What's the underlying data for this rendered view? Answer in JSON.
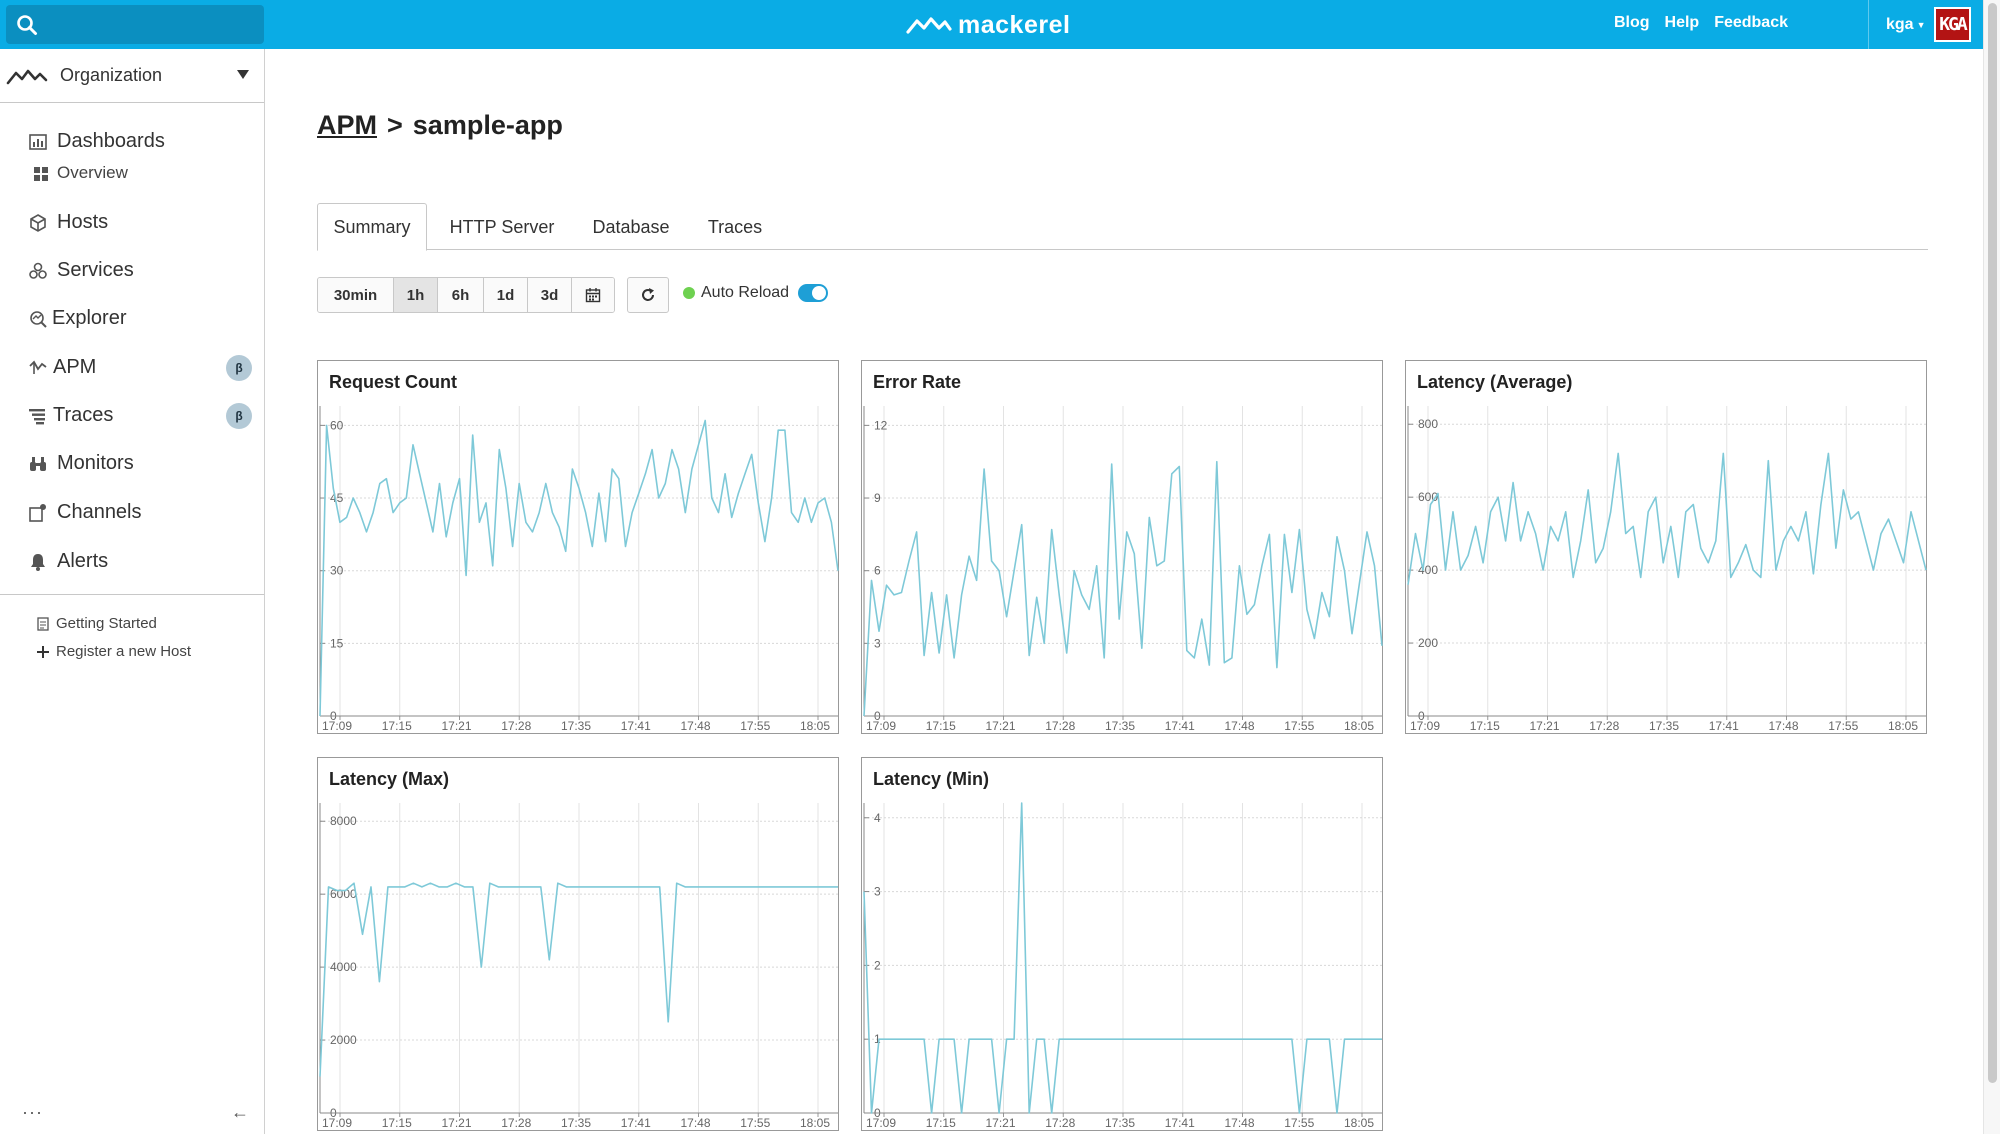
{
  "header": {
    "search_placeholder": "",
    "brand": "mackerel",
    "links": [
      "Blog",
      "Help",
      "Feedback"
    ],
    "user": "kga",
    "avatar_text": "KGA",
    "accent_color": "#0aace5"
  },
  "sidebar": {
    "org": "Organization",
    "items": [
      {
        "label": "Dashboards",
        "icon": "dashboard-icon"
      },
      {
        "label": "Overview",
        "icon": "grid-icon"
      },
      {
        "label": "Hosts",
        "icon": "cube-icon"
      },
      {
        "label": "Services",
        "icon": "services-icon"
      },
      {
        "label": "Explorer",
        "icon": "explorer-icon"
      },
      {
        "label": "APM",
        "icon": "apm-icon",
        "badge": "β"
      },
      {
        "label": "Traces",
        "icon": "traces-icon",
        "badge": "β"
      },
      {
        "label": "Monitors",
        "icon": "binoculars-icon"
      },
      {
        "label": "Channels",
        "icon": "channels-icon"
      },
      {
        "label": "Alerts",
        "icon": "bell-icon"
      }
    ],
    "footer_links": [
      "Getting Started",
      "Register a new Host"
    ],
    "more": "···",
    "collapse": "←"
  },
  "main": {
    "breadcrumb": {
      "parent": "APM",
      "separator": ">",
      "current": "sample-app"
    },
    "tabs": [
      "Summary",
      "HTTP Server",
      "Database",
      "Traces"
    ],
    "active_tab": "Summary",
    "ranges": [
      "30min",
      "1h",
      "6h",
      "1d",
      "3d"
    ],
    "active_range": "1h",
    "auto_reload_label": "Auto Reload",
    "auto_reload_on": true
  },
  "chart_data": [
    {
      "type": "line",
      "title": "Request Count",
      "x_ticks": [
        "17:09",
        "17:15",
        "17:21",
        "17:28",
        "17:35",
        "17:41",
        "17:48",
        "17:55",
        "18:05"
      ],
      "y_ticks": [
        0,
        15,
        30,
        45,
        60
      ],
      "ylim": [
        0,
        64
      ],
      "color": "#7ec9d8",
      "values": [
        0,
        60,
        47,
        40,
        41,
        45,
        42,
        38,
        42,
        48,
        49,
        42,
        44,
        45,
        56,
        50,
        44,
        38,
        48,
        37,
        44,
        49,
        29,
        58,
        40,
        44,
        31,
        55,
        47,
        35,
        48,
        40,
        38,
        42,
        48,
        42,
        39,
        34,
        51,
        47,
        42,
        35,
        46,
        36,
        51,
        49,
        35,
        42,
        46,
        50,
        55,
        45,
        48,
        55,
        51,
        42,
        51,
        56,
        61,
        45,
        42,
        50,
        41,
        46,
        50,
        54,
        44,
        36,
        45,
        59,
        59,
        42,
        40,
        45,
        40,
        44,
        45,
        40,
        30
      ],
      "note": "shape estimate"
    },
    {
      "type": "line",
      "title": "Error Rate",
      "x_ticks": [
        "17:09",
        "17:15",
        "17:21",
        "17:28",
        "17:35",
        "17:41",
        "17:48",
        "17:55",
        "18:05"
      ],
      "y_ticks": [
        0,
        3,
        6,
        9,
        12
      ],
      "ylim": [
        0,
        12.8
      ],
      "color": "#7ec9d8",
      "values": [
        0,
        5.6,
        3.5,
        5.4,
        5,
        5.1,
        6.4,
        7.6,
        2.5,
        5.1,
        2.6,
        5,
        2.4,
        5,
        6.6,
        5.6,
        10.2,
        6.4,
        6,
        4.1,
        6,
        7.9,
        2.5,
        4.9,
        3,
        7.7,
        5,
        2.6,
        6,
        5,
        4.4,
        6.2,
        2.4,
        10.4,
        4,
        7.6,
        6.7,
        2.8,
        8.2,
        6.2,
        6.4,
        10,
        10.3,
        2.7,
        2.4,
        4,
        2.1,
        10.5,
        2.2,
        2.4,
        6.2,
        4.2,
        4.6,
        6.2,
        7.5,
        2,
        7.5,
        5.1,
        7.7,
        4.4,
        3.2,
        5.1,
        4.1,
        7.4,
        6,
        3.4,
        5.5,
        7.6,
        6.2,
        2.9
      ],
      "note": "shape estimate"
    },
    {
      "type": "line",
      "title": "Latency (Average)",
      "x_ticks": [
        "17:09",
        "17:15",
        "17:21",
        "17:28",
        "17:35",
        "17:41",
        "17:48",
        "17:55",
        "18:05"
      ],
      "y_ticks": [
        0,
        200,
        400,
        600,
        800
      ],
      "ylim": [
        0,
        850
      ],
      "color": "#7ec9d8",
      "values": [
        360,
        500,
        400,
        580,
        610,
        400,
        560,
        400,
        440,
        520,
        420,
        560,
        600,
        480,
        640,
        480,
        560,
        500,
        400,
        520,
        480,
        560,
        380,
        480,
        620,
        420,
        460,
        560,
        720,
        500,
        520,
        380,
        560,
        600,
        420,
        520,
        380,
        560,
        580,
        460,
        420,
        480,
        720,
        380,
        420,
        470,
        400,
        380,
        700,
        400,
        480,
        520,
        480,
        560,
        390,
        580,
        720,
        460,
        620,
        540,
        560,
        480,
        400,
        500,
        540,
        480,
        420,
        560,
        480,
        400
      ],
      "note": "shape estimate"
    },
    {
      "type": "line",
      "title": "Latency (Max)",
      "x_ticks": [
        "17:09",
        "17:15",
        "17:21",
        "17:28",
        "17:35",
        "17:41",
        "17:48",
        "17:55",
        "18:05"
      ],
      "y_ticks": [
        0,
        2000,
        4000,
        6000,
        8000
      ],
      "ylim": [
        0,
        8500
      ],
      "color": "#7ec9d8",
      "values": [
        1000,
        6200,
        6100,
        6100,
        6300,
        4900,
        6200,
        3600,
        6200,
        6200,
        6200,
        6300,
        6200,
        6300,
        6200,
        6200,
        6300,
        6200,
        6200,
        4000,
        6300,
        6200,
        6200,
        6200,
        6200,
        6200,
        6200,
        4200,
        6300,
        6200,
        6200,
        6200,
        6200,
        6200,
        6200,
        6200,
        6200,
        6200,
        6200,
        6200,
        6200,
        2500,
        6300,
        6200,
        6200,
        6200,
        6200,
        6200,
        6200,
        6200,
        6200,
        6200,
        6200,
        6200,
        6200,
        6200,
        6200,
        6200,
        6200,
        6200,
        6200,
        6200
      ],
      "note": "shape estimate"
    },
    {
      "type": "line",
      "title": "Latency (Min)",
      "x_ticks": [
        "17:09",
        "17:15",
        "17:21",
        "17:28",
        "17:35",
        "17:41",
        "17:48",
        "17:55",
        "18:05"
      ],
      "y_ticks": [
        0,
        1,
        2,
        3,
        4
      ],
      "ylim": [
        0,
        4.2
      ],
      "color": "#7ec9d8",
      "values": [
        3,
        0,
        1,
        1,
        1,
        1,
        1,
        1,
        1,
        0,
        1,
        1,
        1,
        0,
        1,
        1,
        1,
        1,
        0,
        1,
        1,
        4.2,
        0,
        1,
        1,
        0,
        1,
        1,
        1,
        1,
        1,
        1,
        1,
        1,
        1,
        1,
        1,
        1,
        1,
        1,
        1,
        1,
        1,
        1,
        1,
        1,
        1,
        1,
        1,
        1,
        1,
        1,
        1,
        1,
        1,
        1,
        1,
        1,
        0,
        1,
        1,
        1,
        1,
        0,
        1,
        1,
        1,
        1,
        1,
        1
      ],
      "note": "shape estimate"
    }
  ]
}
